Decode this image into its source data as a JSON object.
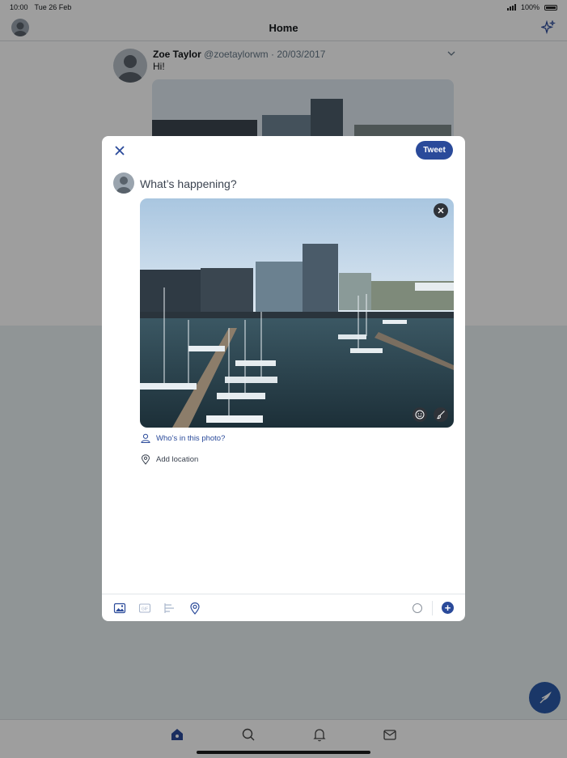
{
  "status_bar": {
    "time": "10:00",
    "date": "Tue 26 Feb",
    "battery": "100%"
  },
  "nav": {
    "title": "Home"
  },
  "timeline_tweet": {
    "name": "Zoe Taylor",
    "meta": "@zoetaylorwm · 20/03/2017",
    "text": "Hi!"
  },
  "composer": {
    "tweet_label": "Tweet",
    "placeholder": "What’s happening?",
    "tag_people": "Who’s in this photo?",
    "add_location": "Add location"
  },
  "icons": {
    "close": "close-icon",
    "sparkle": "sparkle-icon",
    "image": "image-icon",
    "gif": "gif-icon",
    "poll": "poll-icon",
    "location": "location-pin-icon",
    "add": "plus-icon",
    "compose": "feather-icon"
  },
  "colors": {
    "accent": "#2a4a9a",
    "fab": "#2a5aa8",
    "overlay": "rgba(0,0,0,0.38)"
  }
}
